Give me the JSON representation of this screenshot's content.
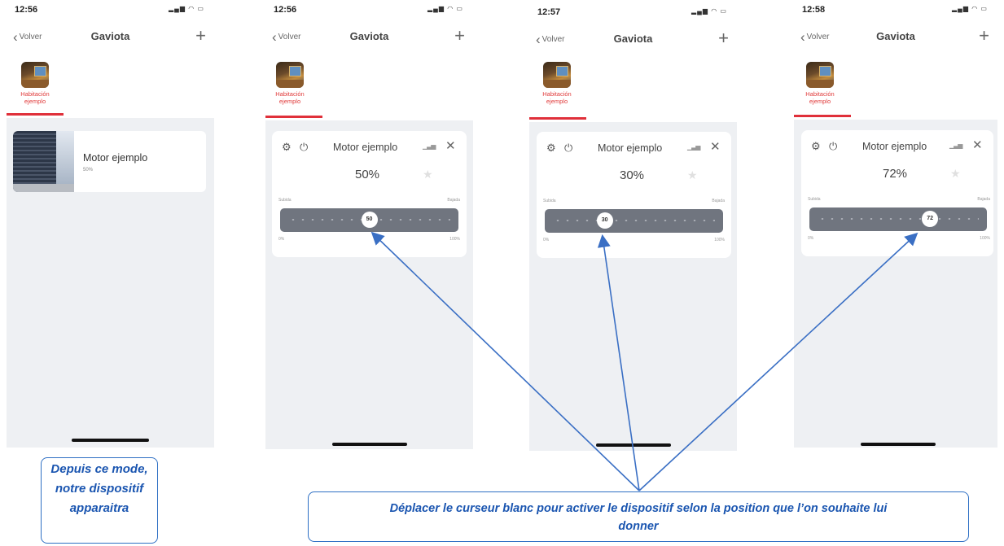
{
  "screens": [
    {
      "time": "12:56",
      "back": "Volver",
      "title": "Gaviota",
      "room": "Habitación ejemplo"
    },
    {
      "time": "12:56",
      "back": "Volver",
      "title": "Gaviota",
      "room": "Habitación ejemplo"
    },
    {
      "time": "12:57",
      "back": "Volver",
      "title": "Gaviota",
      "room": "Habitación ejemplo"
    },
    {
      "time": "12:58",
      "back": "Volver",
      "title": "Gaviota",
      "room": "Habitación ejemplo"
    }
  ],
  "device_card": {
    "name": "Motor ejemplo",
    "value": "50%"
  },
  "controls": [
    {
      "name": "Motor ejemplo",
      "percent": "50%",
      "knob": "50",
      "position": 0.5
    },
    {
      "name": "Motor ejemplo",
      "percent": "30%",
      "knob": "30",
      "position": 0.3
    },
    {
      "name": "Motor ejemplo",
      "percent": "72%",
      "knob": "72",
      "position": 0.72
    }
  ],
  "slider_labels": {
    "up": "Subida",
    "down": "Bajada",
    "min": "0%",
    "max": "100%"
  },
  "icons": {
    "back": "chevron-left-icon",
    "add": "plus-icon",
    "settings": "settings-gear-icon",
    "plug": "plug-icon",
    "signal": "signal-icon",
    "close": "close-icon",
    "favorite": "star-icon"
  },
  "callouts": {
    "left": "Depuis ce mode, notre dispositif apparaitra",
    "right": "Déplacer le curseur blanc pour activer le dispositif selon la position que l’on souhaite lui donner"
  },
  "colors": {
    "accent": "#e0303a",
    "callout": "#2e6fc4",
    "track": "#70757f",
    "background": "#eef0f3"
  }
}
